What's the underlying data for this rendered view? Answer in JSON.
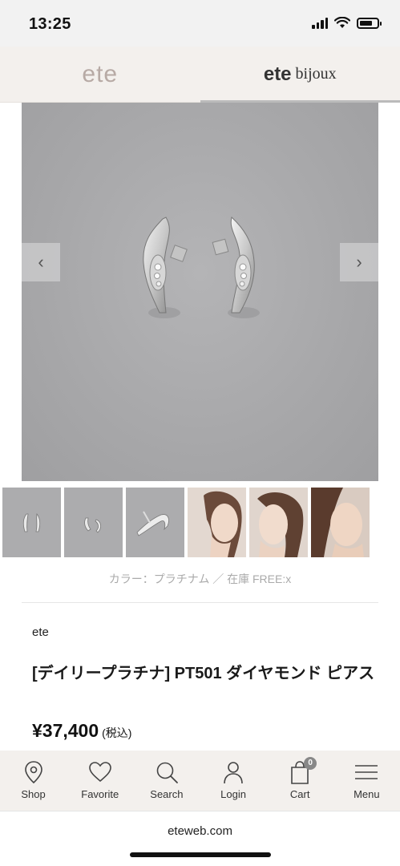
{
  "status_bar": {
    "time": "13:25"
  },
  "brand_tabs": {
    "left_logo": "ete",
    "right_logo": "ete",
    "right_logo_sub": "bijoux"
  },
  "carousel": {
    "prev_icon": "‹",
    "next_icon": "›"
  },
  "color_stock": "カラー：プラチナム ／ 在庫 FREE:x",
  "product": {
    "brand": "ete",
    "title": "[デイリープラチナ] PT501 ダイヤモンド ピアス",
    "price": "¥37,400",
    "tax_note": "(税込)"
  },
  "bottom_nav": {
    "shop": "Shop",
    "favorite": "Favorite",
    "search": "Search",
    "login": "Login",
    "cart": "Cart",
    "cart_count": "0",
    "menu": "Menu"
  },
  "url": "eteweb.com"
}
